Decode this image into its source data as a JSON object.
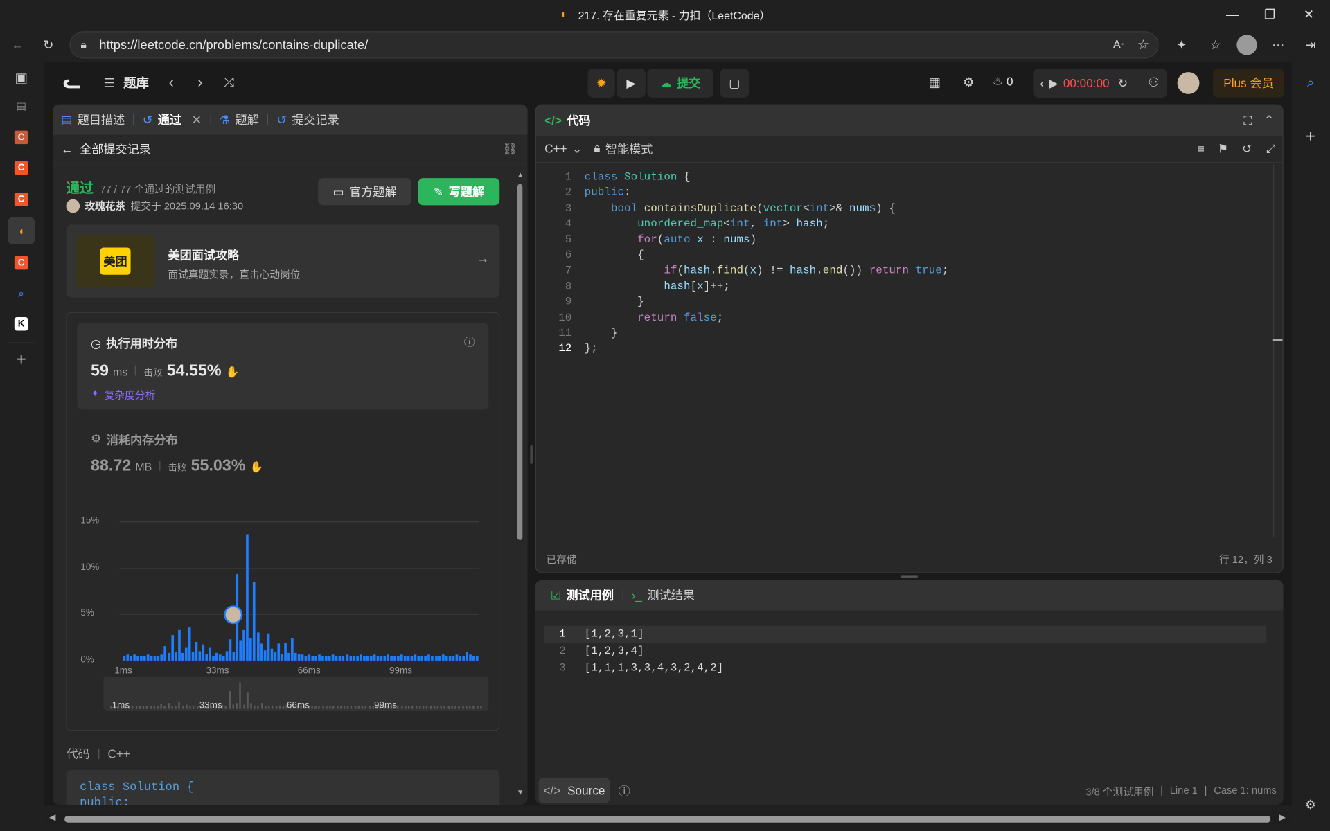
{
  "browser": {
    "window_title": "217. 存在重复元素 - 力扣（LeetCode）",
    "url": "https://leetcode.cn/problems/contains-duplicate/"
  },
  "navbar": {
    "problem_list": "题库",
    "submit": "提交",
    "streak_count": "0",
    "timer": "00:00:00",
    "plus": "Plus 会员"
  },
  "left_tabs": [
    {
      "label": "题目描述"
    },
    {
      "label": "通过"
    },
    {
      "label": "题解"
    },
    {
      "label": "提交记录"
    }
  ],
  "submission": {
    "back_label": "全部提交记录",
    "status": "通过",
    "cases": "77 / 77 个通过的测试用例",
    "user": "玫瑰花茶",
    "submitted_at": "提交于 2025.09.14 16:30",
    "official_solution": "官方题解",
    "write_solution": "写题解"
  },
  "promo": {
    "logo_text": "美团",
    "title": "美团面试攻略",
    "subtitle": "面试真题实录，直击心动岗位"
  },
  "runtime": {
    "title": "执行用时分布",
    "value": "59",
    "unit": "ms",
    "beats_label": "击败",
    "beats": "54.55%",
    "complexity": "复杂度分析"
  },
  "memory": {
    "title": "消耗内存分布",
    "value": "88.72",
    "unit": "MB",
    "beats_label": "击败",
    "beats": "55.03%"
  },
  "chart_data": {
    "type": "bar",
    "y_ticks": [
      "15%",
      "10%",
      "5%",
      "0%"
    ],
    "ylim": [
      0,
      15
    ],
    "x_ticks": [
      "1ms",
      "33ms",
      "66ms",
      "99ms"
    ],
    "values": [
      0.5,
      0.6,
      0.5,
      0.6,
      0.5,
      0.5,
      0.5,
      0.6,
      0.5,
      0.5,
      0.5,
      0.6,
      1.6,
      0.8,
      2.7,
      0.9,
      3.3,
      0.8,
      1.4,
      3.6,
      0.9,
      2.0,
      1.0,
      1.7,
      0.7,
      1.4,
      0.5,
      0.8,
      0.6,
      0.5,
      1.0,
      2.3,
      0.9,
      9.3,
      2.2,
      3.3,
      13.6,
      2.4,
      8.5,
      3.0,
      1.8,
      1.1,
      2.9,
      1.3,
      0.9,
      1.8,
      0.7,
      1.9,
      0.8,
      2.4,
      0.8,
      0.7,
      0.6,
      0.5,
      0.6,
      0.5,
      0.5,
      0.6,
      0.5,
      0.5,
      0.5,
      0.6,
      0.5,
      0.5,
      0.5,
      0.6,
      0.5,
      0.5,
      0.5,
      0.6,
      0.5,
      0.5,
      0.5,
      0.6,
      0.5,
      0.5,
      0.5,
      0.6,
      0.5,
      0.5,
      0.5,
      0.6,
      0.5,
      0.5,
      0.5,
      0.6,
      0.5,
      0.5,
      0.5,
      0.6,
      0.5,
      0.5,
      0.5,
      0.6,
      0.5,
      0.5,
      0.5,
      0.6,
      0.5,
      0.5,
      0.9,
      0.6,
      0.5,
      0.5
    ],
    "highlight_index": 32,
    "title": "",
    "xlabel": "",
    "ylabel": ""
  },
  "minimap": {
    "x_ticks": [
      "1ms",
      "33ms",
      "66ms",
      "99ms"
    ]
  },
  "code_section": {
    "label": "代码",
    "lang": "C++",
    "preview_line1": "class Solution {",
    "preview_line2": "public:"
  },
  "editor": {
    "title": "代码",
    "language": "C++",
    "mode": "智能模式",
    "saved": "已存储",
    "cursor": "行 12，列 3",
    "lines": [
      "class Solution {",
      "public:",
      "    bool containsDuplicate(vector<int>& nums) {",
      "        unordered_map<int, int> hash;",
      "        for(auto x : nums)",
      "        {",
      "            if(hash.find(x) != hash.end()) return true;",
      "            hash[x]++;",
      "        }",
      "        return false;",
      "    }",
      "};"
    ]
  },
  "tests": {
    "tab_cases": "测试用例",
    "tab_results": "测试结果",
    "cases": [
      "[1,2,3,1]",
      "[1,2,3,4]",
      "[1,1,1,3,3,4,3,2,4,2]"
    ],
    "source": "Source",
    "footer_count": "3/8 个测试用例",
    "footer_line": "Line 1",
    "footer_case": "Case 1: nums"
  },
  "colors": {
    "accent_green": "#2db55d",
    "accent_blue": "#1f7cff",
    "plus_orange": "#ffa116",
    "timer_red": "#ff4d4f"
  }
}
